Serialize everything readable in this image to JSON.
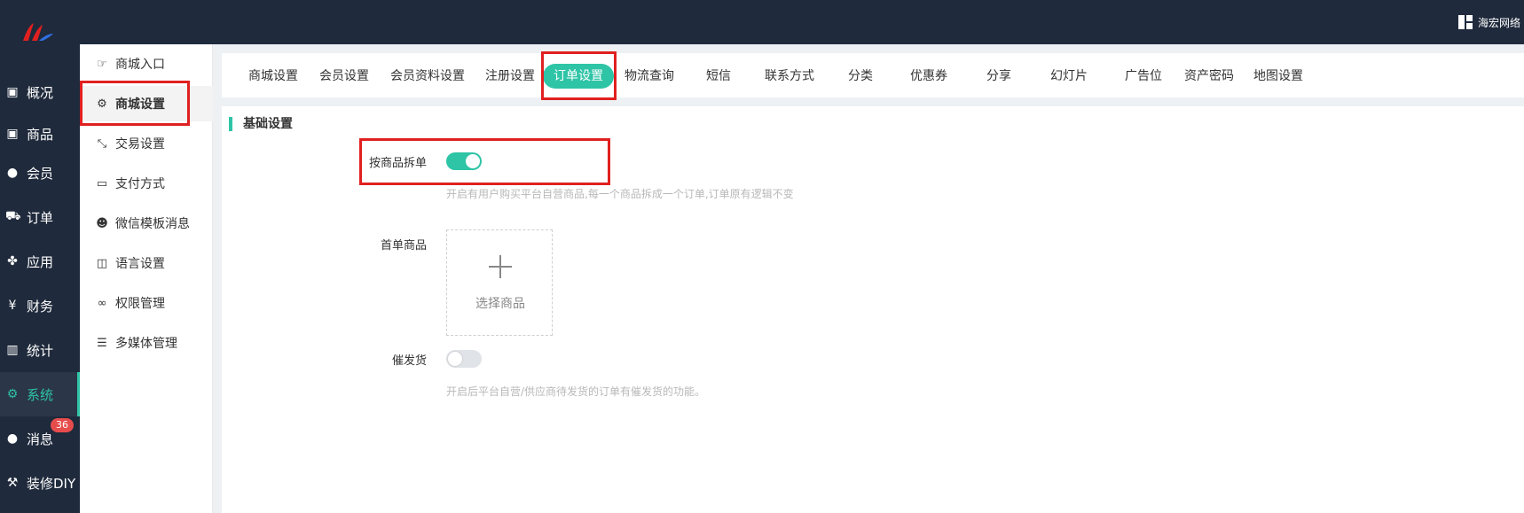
{
  "brand": {
    "name": "海宏网络",
    "icon": "grid-icon"
  },
  "colors": {
    "accent": "#2ec4a6",
    "sidebar": "#1f2a3c",
    "highlight_box": "#e02020",
    "badge": "#e74c4c"
  },
  "sidebar": {
    "items": [
      {
        "label": "概况",
        "icon": "dashboard-icon"
      },
      {
        "label": "商品",
        "icon": "goods-icon"
      },
      {
        "label": "会员",
        "icon": "users-icon"
      },
      {
        "label": "订单",
        "icon": "cart-icon"
      },
      {
        "label": "应用",
        "icon": "apps-icon"
      },
      {
        "label": "财务",
        "icon": "yen-icon"
      },
      {
        "label": "统计",
        "icon": "bar-chart-icon"
      },
      {
        "label": "系统",
        "icon": "gears-icon",
        "active": true
      },
      {
        "label": "消息",
        "icon": "comment-icon",
        "badge": "36"
      },
      {
        "label": "装修DIY",
        "icon": "hammer-icon"
      }
    ]
  },
  "subnav": {
    "items": [
      {
        "label": "商城入口",
        "icon": "pointer-hand-icon"
      },
      {
        "label": "商城设置",
        "icon": "gear-icon",
        "active": true
      },
      {
        "label": "交易设置",
        "icon": "exchange-icon"
      },
      {
        "label": "支付方式",
        "icon": "credit-card-icon"
      },
      {
        "label": "微信模板消息",
        "icon": "wechat-icon"
      },
      {
        "label": "语言设置",
        "icon": "translate-icon"
      },
      {
        "label": "权限管理",
        "icon": "mask-icon"
      },
      {
        "label": "多媒体管理",
        "icon": "list-icon"
      }
    ]
  },
  "tabs": [
    {
      "label": "商城设置"
    },
    {
      "label": "会员设置"
    },
    {
      "label": "会员资料设置"
    },
    {
      "label": "注册设置"
    },
    {
      "label": "订单设置",
      "active": true
    },
    {
      "label": "物流查询"
    },
    {
      "label": "短信"
    },
    {
      "label": "联系方式"
    },
    {
      "label": "分类"
    },
    {
      "label": "优惠券"
    },
    {
      "label": "分享"
    },
    {
      "label": "幻灯片"
    },
    {
      "label": "广告位"
    },
    {
      "label": "资产密码"
    },
    {
      "label": "地图设置"
    }
  ],
  "section": {
    "title": "基础设置",
    "split_order": {
      "label": "按商品拆单",
      "enabled": true,
      "hint": "开启有用户购买平台自营商品,每一个商品拆成一个订单,订单原有逻辑不变"
    },
    "first_order_goods": {
      "label": "首单商品",
      "picker_label": "选择商品"
    },
    "urge_shipping": {
      "label": "催发货",
      "enabled": false,
      "hint": "开启后平台自营/供应商待发货的订单有催发货的功能。"
    }
  }
}
